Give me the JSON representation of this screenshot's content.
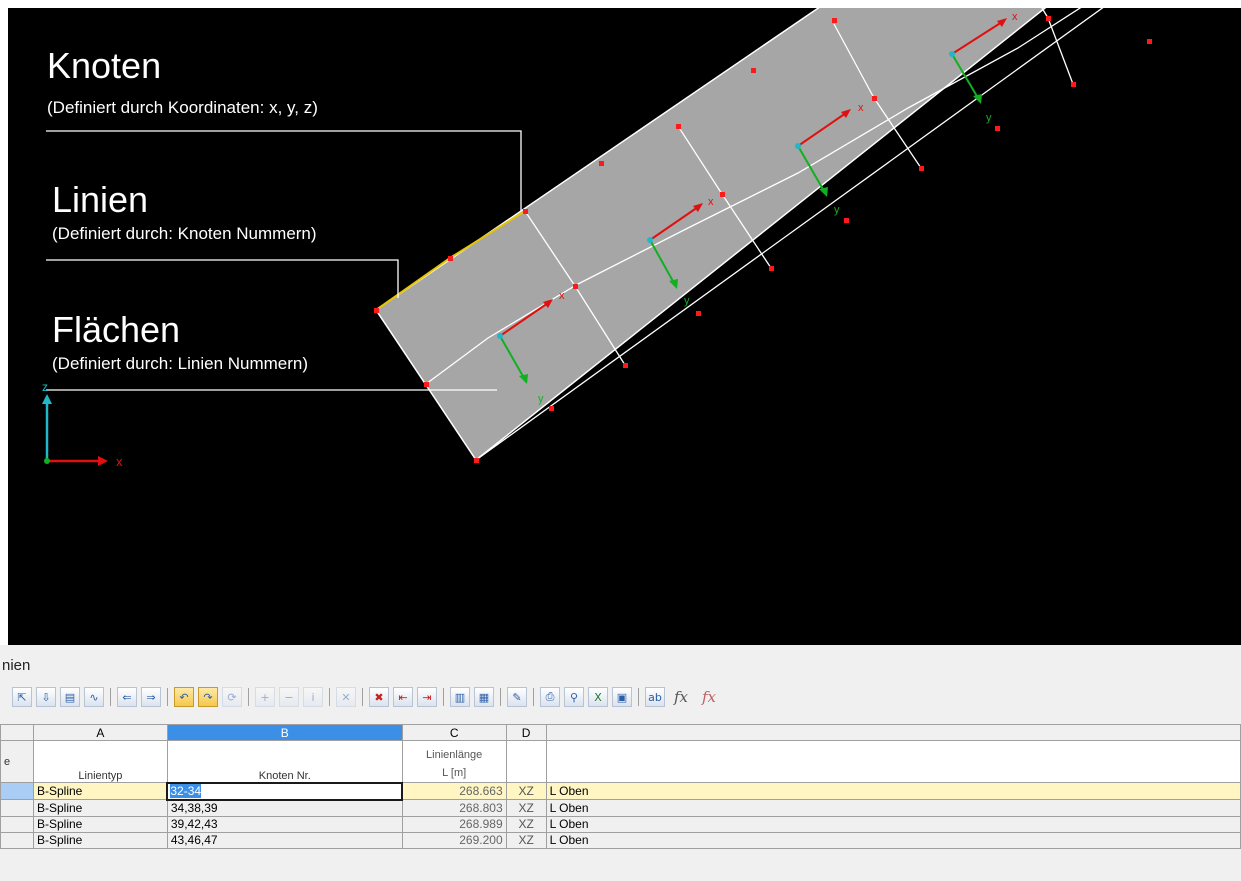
{
  "annotations": {
    "knoten_title": "Knoten",
    "knoten_sub": "(Definiert durch Koordinaten: x, y, z)",
    "linien_title": "Linien",
    "linien_sub": "(Definiert durch:  Knoten Nummern)",
    "flaechen_title": "Flächen",
    "flaechen_sub": "(Definiert durch:  Linien Nummern)"
  },
  "axes": {
    "z": "z",
    "x": "x"
  },
  "local_axes": {
    "x": "x",
    "y": "y"
  },
  "colors": {
    "surface": "#a6a6a6",
    "node": "#ff1a1a",
    "selected_line": "#e8c400",
    "x_axis": "#e01010",
    "y_axis": "#10b020",
    "z_axis": "#20b8c8",
    "grid_selected": "#3c8fe6",
    "row_current": "#fff6c4"
  },
  "panel": {
    "title": "nien",
    "toolbar": [
      "table-first-icon",
      "table-import-icon",
      "table-filter-icon",
      "table-chart-icon",
      "arrow-left-icon",
      "arrow-right-icon",
      "undo-icon",
      "redo-icon",
      "refresh-icon",
      "zoom-in-icon",
      "zoom-out-icon",
      "info-icon",
      "delete-icon",
      "delete-rows-icon",
      "insert-row-icon",
      "append-row-icon",
      "columns-icon",
      "columns-edit-icon",
      "edit-note-icon",
      "print-icon",
      "search-icon",
      "excel-icon",
      "calculator-icon",
      "rename-icon",
      "fx-icon",
      "fx-delete-icon"
    ]
  },
  "grid": {
    "col_letters": [
      "A",
      "B",
      "C",
      "D",
      ""
    ],
    "left_header": "e",
    "headers": [
      "Linientyp",
      "Knoten Nr.",
      "Linienlänge\nL [m]",
      "",
      ""
    ],
    "header_c_top": "Linienlänge",
    "header_c_bottom": "L [m]",
    "rows": [
      {
        "type": "B-Spline",
        "nodes": "32-34",
        "length": "268.663",
        "plane": "XZ",
        "comment": "L Oben"
      },
      {
        "type": "B-Spline",
        "nodes": "34,38,39",
        "length": "268.803",
        "plane": "XZ",
        "comment": "L Oben"
      },
      {
        "type": "B-Spline",
        "nodes": "39,42,43",
        "length": "268.989",
        "plane": "XZ",
        "comment": "L Oben"
      },
      {
        "type": "B-Spline",
        "nodes": "43,46,47",
        "length": "269.200",
        "plane": "XZ",
        "comment": "L Oben"
      }
    ]
  }
}
